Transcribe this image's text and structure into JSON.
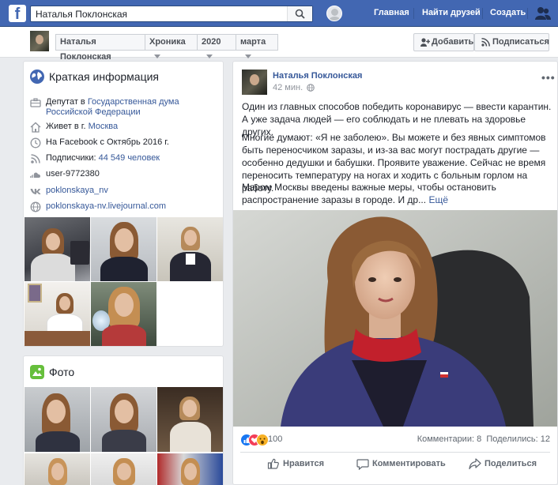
{
  "topbar": {
    "logo": "f",
    "search_value": "Наталья Поклонская",
    "links": [
      "Главная",
      "Найти друзей",
      "Создать"
    ],
    "icons": [
      "search-icon",
      "friend-requests-icon"
    ]
  },
  "subbar": {
    "breadcrumbs": [
      "Наталья Поклонская",
      "Хроника",
      "2020",
      "марта"
    ],
    "add_button": "Добавить",
    "follow_button": "Подписаться"
  },
  "intro": {
    "title": "Краткая информация",
    "rows": [
      {
        "icon": "briefcase-icon",
        "prefix": "Депутат в ",
        "link": "Государственная дума Российской Федерации"
      },
      {
        "icon": "home-icon",
        "prefix": "Живет в г. ",
        "link": "Москва"
      },
      {
        "icon": "clock-icon",
        "prefix": "На Facebook с Октябрь 2016 г.",
        "link": ""
      },
      {
        "icon": "rss-icon",
        "prefix": "Подписчики: ",
        "link": "44 549 человек"
      },
      {
        "icon": "soundcloud-icon",
        "prefix": "user-9772380",
        "link": ""
      },
      {
        "icon": "vk-icon",
        "prefix": "",
        "link": "poklonskaya_nv"
      },
      {
        "icon": "globe-icon",
        "prefix": "",
        "link": "poklonskaya-nv.livejournal.com"
      }
    ]
  },
  "photos_card": {
    "title": "Фото"
  },
  "post": {
    "author": "Наталья Поклонская",
    "time": "42 мин.",
    "more": "•••",
    "paragraphs": [
      "Один из главных способов победить коронавирус — ввести карантин. А уже задача людей — его соблюдать и не плевать на здоровье других.",
      "Многие думают: «Я не заболею». Вы можете и без явных симптомов быть переносчиком заразы, и из-за вас могут пострадать другие — особенно дедушки и бабушки. Проявите уважение. Сейчас не время переносить температуру на ногах и ходить с больным горлом на работу.",
      "Мэром Москвы введены важные меры, чтобы остановить распространение заразы в городе. И др..."
    ],
    "see_more": "Ещё",
    "reaction_count": "100",
    "comments": "Комментарии: 8",
    "shares": "Поделились: 12",
    "actions": [
      "Нравится",
      "Комментировать",
      "Поделиться"
    ]
  },
  "colors": {
    "brand": "#4267b2",
    "link": "#365899",
    "background": "#e9ebee"
  }
}
